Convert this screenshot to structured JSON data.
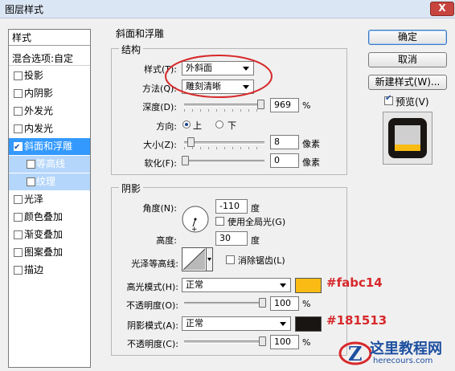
{
  "window": {
    "title": "图层样式",
    "close_label": "X"
  },
  "style_list": {
    "header": "样式",
    "blend_options": "混合选项:自定",
    "items": [
      {
        "label": "投影",
        "checked": false
      },
      {
        "label": "内阴影",
        "checked": false
      },
      {
        "label": "外发光",
        "checked": false
      },
      {
        "label": "内发光",
        "checked": false
      },
      {
        "label": "斜面和浮雕",
        "checked": true,
        "selected": true
      },
      {
        "label": "等高线",
        "checked": false,
        "sub": true
      },
      {
        "label": "纹理",
        "checked": false,
        "sub": true
      },
      {
        "label": "光泽",
        "checked": false
      },
      {
        "label": "颜色叠加",
        "checked": false
      },
      {
        "label": "渐变叠加",
        "checked": false
      },
      {
        "label": "图案叠加",
        "checked": false
      },
      {
        "label": "描边",
        "checked": false
      }
    ]
  },
  "bevel": {
    "section_title": "斜面和浮雕",
    "structure": {
      "title": "结构",
      "style_label": "样式(T):",
      "style_value": "外斜面",
      "technique_label": "方法(Q):",
      "technique_value": "雕刻清晰",
      "depth_label": "深度(D):",
      "depth_value": "969",
      "depth_unit": "%",
      "depth_slider_fraction": 0.97,
      "direction_label": "方向:",
      "direction_up": "上",
      "direction_down": "下",
      "direction_selected": "上",
      "size_label": "大小(Z):",
      "size_value": "8",
      "size_unit": "像素",
      "soften_label": "软化(F):",
      "soften_value": "0",
      "soften_unit": "像素"
    },
    "shading": {
      "title": "阴影",
      "angle_label": "角度(N):",
      "angle_value": "-110",
      "angle_unit": "度",
      "global_light_label": "使用全局光(G)",
      "global_light_checked": false,
      "altitude_label": "高度:",
      "altitude_value": "30",
      "altitude_unit": "度",
      "gloss_contour_label": "光泽等高线:",
      "antialias_label": "消除锯齿(L)",
      "highlight_mode_label": "高光模式(H):",
      "highlight_mode_value": "正常",
      "highlight_color": "#fabc14",
      "highlight_opacity_label": "不透明度(O):",
      "highlight_opacity_value": "100",
      "highlight_opacity_unit": "%",
      "shadow_mode_label": "阴影模式(A):",
      "shadow_mode_value": "正常",
      "shadow_color": "#181513",
      "shadow_opacity_label": "不透明度(C):",
      "shadow_opacity_value": "100",
      "shadow_opacity_unit": "%"
    }
  },
  "buttons": {
    "ok": "确定",
    "cancel": "取消",
    "new_style": "新建样式(W)...",
    "preview_label": "预览(V)",
    "preview_checked": true
  },
  "annotations": {
    "highlight_hex": "#fabc14",
    "shadow_hex": "#181513",
    "annotation_color": "#d7282a"
  },
  "watermark": {
    "name": "这里教程网",
    "url": "herecours.com",
    "logo_letter": "Z"
  }
}
